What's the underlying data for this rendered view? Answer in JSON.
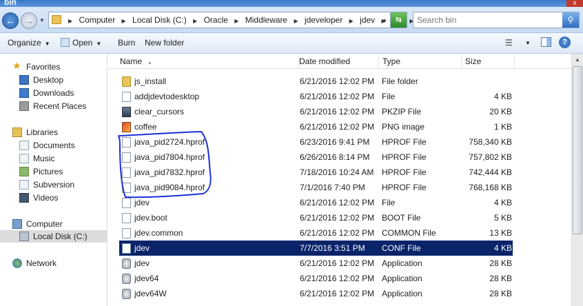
{
  "window": {
    "title": "bin",
    "close_glyph": "x"
  },
  "address_bar": {
    "path": [
      "Computer",
      "Local Disk (C:)",
      "Oracle",
      "Middleware",
      "jdeveloper",
      "jdev",
      "bin"
    ]
  },
  "search": {
    "placeholder": "Search bin",
    "icon": "magnifier-icon"
  },
  "toolbar": {
    "organize_label": "Organize",
    "open_label": "Open",
    "burn_label": "Burn",
    "new_folder_label": "New folder"
  },
  "navigation": {
    "favorites_label": "Favorites",
    "desktop_label": "Desktop",
    "downloads_label": "Downloads",
    "recent_places_label": "Recent Places",
    "libraries_label": "Libraries",
    "documents_label": "Documents",
    "music_label": "Music",
    "pictures_label": "Pictures",
    "subversion_label": "Subversion",
    "videos_label": "Videos",
    "computer_label": "Computer",
    "local_disk_label": "Local Disk (C:)",
    "network_label": "Network",
    "selected": "Local Disk (C:)"
  },
  "columns": {
    "name": "Name",
    "date_modified": "Date modified",
    "type": "Type",
    "size": "Size"
  },
  "files": [
    {
      "name": "js_install",
      "date": "6/21/2016 12:02 PM",
      "type": "File folder",
      "size": "",
      "icon": "folder-icon"
    },
    {
      "name": "addjdevtodesktop",
      "date": "6/21/2016 12:02 PM",
      "type": "File",
      "size": "4 KB",
      "icon": "file-icon"
    },
    {
      "name": "clear_cursors",
      "date": "6/21/2016 12:02 PM",
      "type": "PKZIP File",
      "size": "20 KB",
      "icon": "zip-icon"
    },
    {
      "name": "coffee",
      "date": "6/21/2016 12:02 PM",
      "type": "PNG image",
      "size": "1 KB",
      "icon": "png-icon"
    },
    {
      "name": "java_pid2724.hprof",
      "date": "6/23/2016 9:41 PM",
      "type": "HPROF File",
      "size": "758,340 KB",
      "icon": "file-icon"
    },
    {
      "name": "java_pid7804.hprof",
      "date": "6/26/2016 8:14 PM",
      "type": "HPROF File",
      "size": "757,802 KB",
      "icon": "file-icon"
    },
    {
      "name": "java_pid7832.hprof",
      "date": "7/18/2016 10:24 AM",
      "type": "HPROF File",
      "size": "742,444 KB",
      "icon": "file-icon"
    },
    {
      "name": "java_pid9084.hprof",
      "date": "7/1/2016 7:40 PM",
      "type": "HPROF File",
      "size": "768,168 KB",
      "icon": "file-icon"
    },
    {
      "name": "jdev",
      "date": "6/21/2016 12:02 PM",
      "type": "File",
      "size": "4 KB",
      "icon": "file-icon"
    },
    {
      "name": "jdev.boot",
      "date": "6/21/2016 12:02 PM",
      "type": "BOOT File",
      "size": "5 KB",
      "icon": "file-icon"
    },
    {
      "name": "jdev.common",
      "date": "6/21/2016 12:02 PM",
      "type": "COMMON File",
      "size": "13 KB",
      "icon": "file-icon"
    },
    {
      "name": "jdev",
      "date": "7/7/2016 3:51 PM",
      "type": "CONF File",
      "size": "4 KB",
      "icon": "conf-icon",
      "selected": true
    },
    {
      "name": "jdev",
      "date": "6/21/2016 12:02 PM",
      "type": "Application",
      "size": "28 KB",
      "icon": "app-icon"
    },
    {
      "name": "jdev64",
      "date": "6/21/2016 12:02 PM",
      "type": "Application",
      "size": "28 KB",
      "icon": "app-icon"
    },
    {
      "name": "jdev64W",
      "date": "6/21/2016 12:02 PM",
      "type": "Application",
      "size": "28 KB",
      "icon": "app-icon"
    }
  ],
  "annotation": {
    "color": "#1a2fd6",
    "encloses": "hprof files"
  },
  "colors": {
    "selection": "#0a246a",
    "accent": "#3a79c7"
  }
}
